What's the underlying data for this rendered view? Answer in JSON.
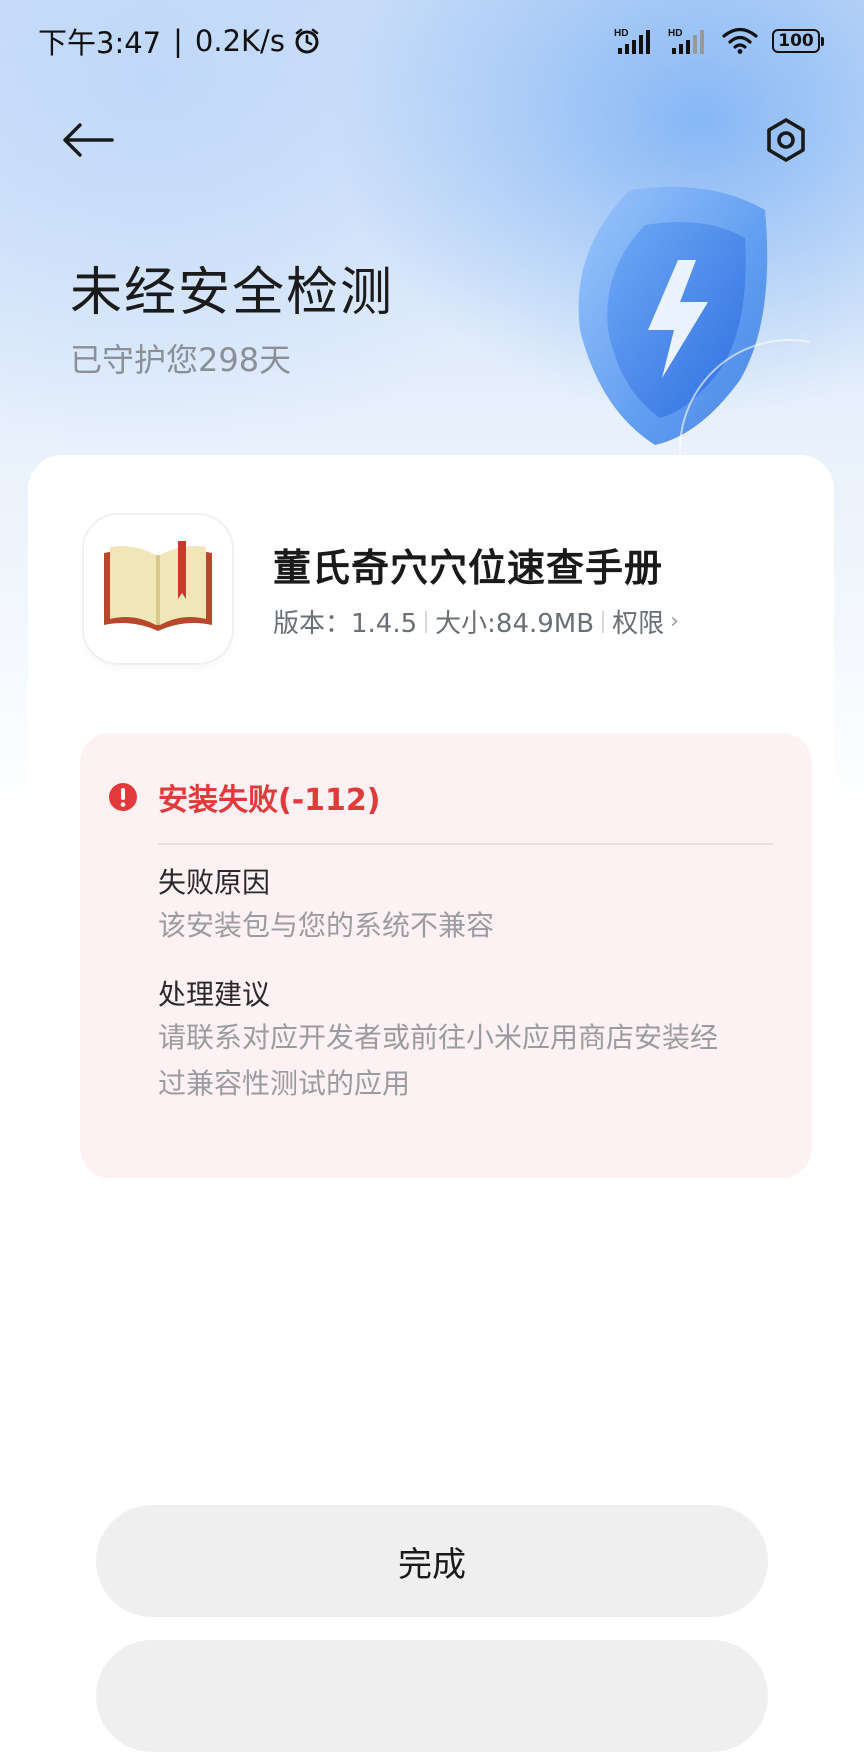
{
  "status_bar": {
    "time": "下午3:47",
    "speed": "0.2K/s",
    "signal1_label": "HD",
    "signal2_label": "HD",
    "battery": "100"
  },
  "header": {
    "title": "未经安全检测",
    "subtitle": "已守护您298天"
  },
  "app": {
    "name": "董氏奇穴穴位速查手册",
    "version": "版本：1.4.5",
    "size": "大小:84.9MB",
    "permissions": "权限",
    "icon": "book-icon"
  },
  "error": {
    "title": "安装失败(-112)",
    "reason_label": "失败原因",
    "reason_text": "该安装包与您的系统不兼容",
    "suggestion_label": "处理建议",
    "suggestion_text": "请联系对应开发者或前往小米应用商店安装经过兼容性测试的应用",
    "color": "#e23a3a"
  },
  "actions": {
    "done_label": "完成"
  },
  "colors": {
    "accent_blue": "#4a90f0",
    "error_bg": "#fdf1f3",
    "button_bg": "#efefef"
  }
}
